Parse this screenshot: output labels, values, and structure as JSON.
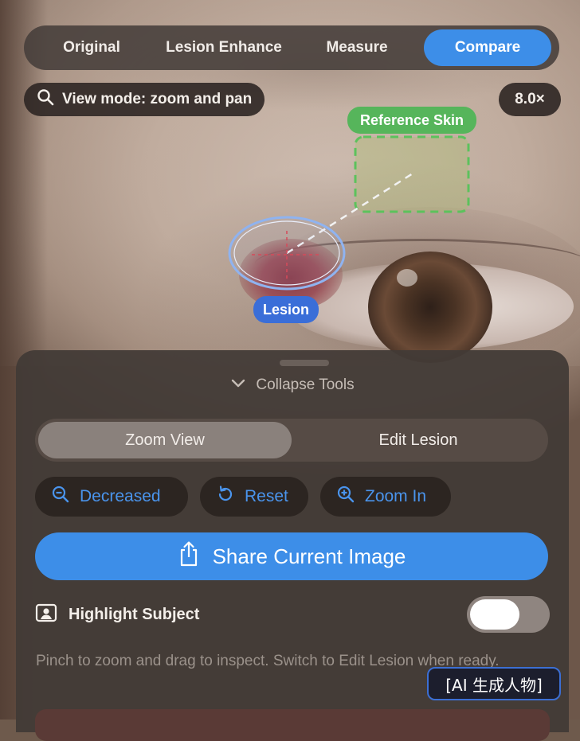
{
  "tabs": [
    {
      "label": "Original",
      "active": false
    },
    {
      "label": "Lesion Enhance",
      "active": false
    },
    {
      "label": "Measure",
      "active": false
    },
    {
      "label": "Compare",
      "active": true
    }
  ],
  "view_mode": {
    "label": "View mode: zoom and pan",
    "icon": "search-icon"
  },
  "zoom_level": "8.0×",
  "annotations": {
    "reference_label": "Reference Skin",
    "lesion_label": "Lesion"
  },
  "tools_panel": {
    "collapse_label": "Collapse Tools",
    "modes": [
      {
        "label": "Zoom View",
        "selected": true
      },
      {
        "label": "Edit Lesion",
        "selected": false
      }
    ],
    "tool_buttons": {
      "decrease": {
        "label": "Decreased",
        "icon": "zoom-out-icon"
      },
      "reset": {
        "label": "Reset",
        "icon": "rotate-ccw-icon"
      },
      "zoom_in": {
        "label": "Zoom In",
        "icon": "zoom-in-icon"
      }
    },
    "share_label": "Share Current Image",
    "highlight_subject": {
      "label": "Highlight Subject",
      "enabled": false
    },
    "hint": "Pinch to zoom and drag to inspect. Switch to Edit Lesion when ready."
  },
  "watermark": "[AI 生成人物]",
  "colors": {
    "accent": "#3d8ee8",
    "reference": "#56b55b",
    "lesion": "#3a6ed8",
    "tool_text": "#4a94ec"
  }
}
